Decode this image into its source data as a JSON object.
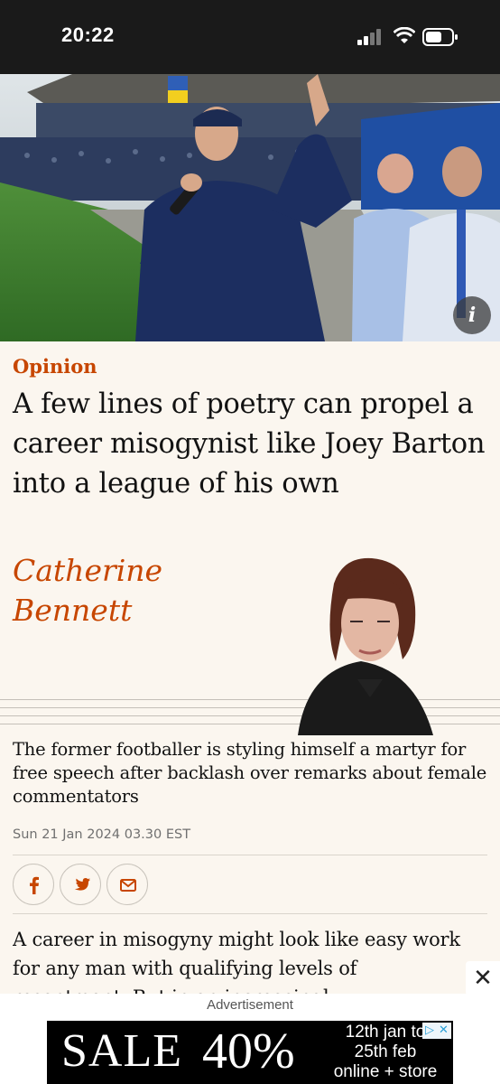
{
  "status": {
    "time": "20:22"
  },
  "hero": {
    "info_label": "i"
  },
  "article": {
    "kicker": "Opinion",
    "headline": "A few lines of poetry can propel a career misogynist like Joey Barton into a league of his own",
    "byline": "Catherine Bennett",
    "standfirst": "The former footballer is styling himself a martyr for free speech after backlash over remarks about female commentators",
    "dateline": "Sun 21 Jan 2024 03.30 EST",
    "share": [
      {
        "icon": "facebook-icon",
        "label": "f"
      },
      {
        "icon": "twitter-icon"
      },
      {
        "icon": "email-icon"
      }
    ],
    "body": "A career in misogyny might look like easy work for any man with qualifying levels of resentment. But in an increasingly"
  },
  "ad": {
    "label": "Advertisement",
    "close": "✕",
    "sale_text": "SALE",
    "sale_number": "40%",
    "dates_line1": "12th jan to",
    "dates_line2": "25th feb",
    "dates_line3": "online + store"
  },
  "colors": {
    "accent": "#c74600",
    "background": "#fbf6ef",
    "text": "#121212"
  }
}
